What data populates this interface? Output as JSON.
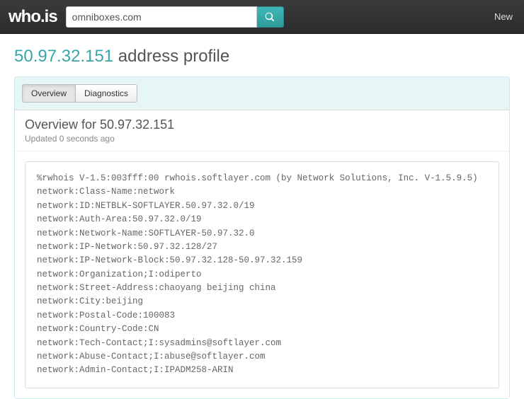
{
  "logo": "who.is",
  "search": {
    "value": "omniboxes.com"
  },
  "nav": {
    "new": "New"
  },
  "heading": {
    "ip": "50.97.32.151",
    "suffix": " address profile"
  },
  "tabs": {
    "overview": "Overview",
    "diagnostics": "Diagnostics"
  },
  "section": {
    "title_prefix": "Overview for ",
    "title_ip": "50.97.32.151",
    "updated": "Updated 0 seconds ago"
  },
  "whois_lines": [
    "%rwhois V-1.5:003fff:00 rwhois.softlayer.com (by Network Solutions, Inc. V-1.5.9.5)",
    "network:Class-Name:network",
    "network:ID:NETBLK-SOFTLAYER.50.97.32.0/19",
    "network:Auth-Area:50.97.32.0/19",
    "network:Network-Name:SOFTLAYER-50.97.32.0",
    "network:IP-Network:50.97.32.128/27",
    "network:IP-Network-Block:50.97.32.128-50.97.32.159",
    "network:Organization;I:odiperto",
    "network:Street-Address:chaoyang beijing china",
    "network:City:beijing",
    "network:Postal-Code:100083",
    "network:Country-Code:CN",
    "network:Tech-Contact;I:sysadmins@softlayer.com",
    "network:Abuse-Contact;I:abuse@softlayer.com",
    "network:Admin-Contact;I:IPADM258-ARIN"
  ]
}
